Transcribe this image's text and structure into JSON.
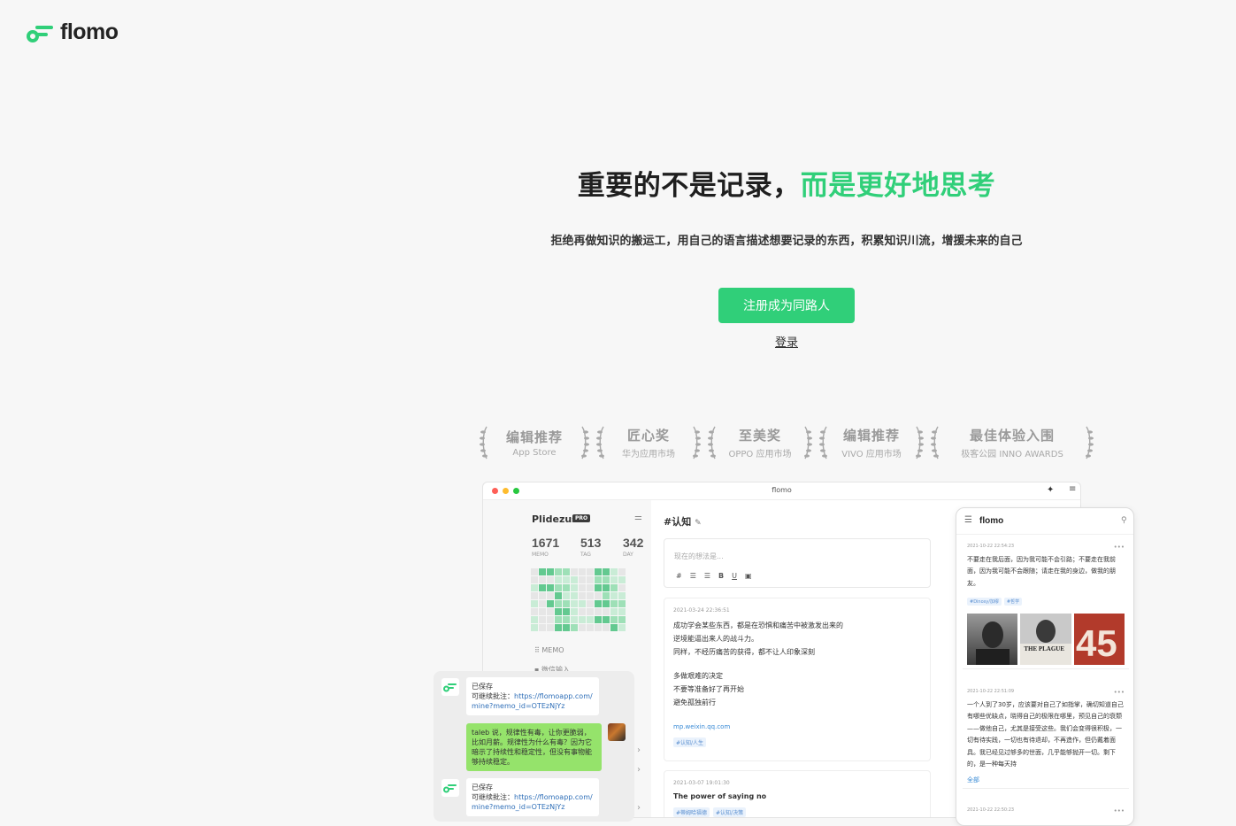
{
  "brand": {
    "name": "flomo",
    "accent": "#30cf79"
  },
  "hero": {
    "title_black": "重要的不是记录，",
    "title_green": "而是更好地思考",
    "subtitle": "拒绝再做知识的搬运工，用自己的语言描述想要记录的东西，积累知识川流，增援未来的自己",
    "signup_label": "注册成为同路人",
    "login_label": "登录"
  },
  "awards": [
    {
      "title": "编辑推荐",
      "source": "App Store"
    },
    {
      "title": "匠心奖",
      "source": "华为应用市场"
    },
    {
      "title": "至美奖",
      "source": "OPPO 应用市场"
    },
    {
      "title": "编辑推荐",
      "source": "VIVO 应用市场"
    },
    {
      "title": "最佳体验入围",
      "source": "极客公园 INNO AWARDS"
    }
  ],
  "desktop": {
    "window_title": "flomo",
    "username": "Plidezus",
    "pro_badge": "PRO",
    "stats": [
      {
        "value": "1671",
        "label": "MEMO"
      },
      {
        "value": "513",
        "label": "TAG"
      },
      {
        "value": "342",
        "label": "DAY"
      }
    ],
    "side_memo": "MEMO",
    "side_wechat": "微信输入",
    "tag_title": "#认知",
    "editor_placeholder": "现在的想法是...",
    "editor_tools": [
      "#",
      "☰",
      "☰",
      "B",
      "U",
      "▣"
    ],
    "memo1": {
      "time": "2021-03-24 22:36:51",
      "lines": [
        "成功学会某些东西，都是在恐惧和痛苦中被激发出来的",
        "逆境能逼出来人的战斗力。",
        "同样，不经历痛苦的获得，都不让人印象深刻"
      ],
      "lines2": [
        "多做艰难的决定",
        "不要等准备好了再开始",
        "避免孤独前行"
      ],
      "link": "mp.weixin.qq.com",
      "tag": "#认知/人生"
    },
    "memo2": {
      "time": "2021-03-07 19:01:30",
      "line": "The power of saying no",
      "tags": [
        "#蒂姆哈福德",
        "#认知/决策"
      ]
    }
  },
  "phone": {
    "logo": "flomo",
    "card1": {
      "time": "2021-10-22 22:54:23",
      "text": "不要走在我后面，因为我可能不会引路；不要走在我前面，因为我可能不会跟随；请走在我的身边，做我的朋友。",
      "tags": [
        "#Dinosy/加缪",
        "#哲学"
      ],
      "book_title": "THE PLAGUE"
    },
    "card2": {
      "time": "2021-10-22 22:51:09",
      "text": "一个人到了30岁，应该要对自己了如指掌，确切知道自己有哪些优缺点，晓得自己的极限在哪里，预见自己的衰颓——做他自己，尤其是接受这些。我们会变得很积极，一切有待实践，一切也有待退却，不再造作，但仍戴着面具。我已经见过够多的世面，几乎能够抛开一切。剩下的，是一种每天持",
      "more": "全部"
    },
    "card3_time": "2021-10-22 22:50:23"
  },
  "chat": {
    "saved1": "已保存",
    "note_label": "可继续批注：",
    "url1": "https://flomoapp.com/",
    "url1b": "mine?memo_id=OTEzNjYz",
    "green_msg": "taleb 说，规律性有毒，让你更脆弱，比如月薪。规律性为什么有毒？因为它暗示了持续性和稳定性，但没有事物能够持续稳定。",
    "saved2": "已保存",
    "url2": "https://flomoapp.com/",
    "url2b": "mine?memo_id=OTEzNjYz"
  }
}
